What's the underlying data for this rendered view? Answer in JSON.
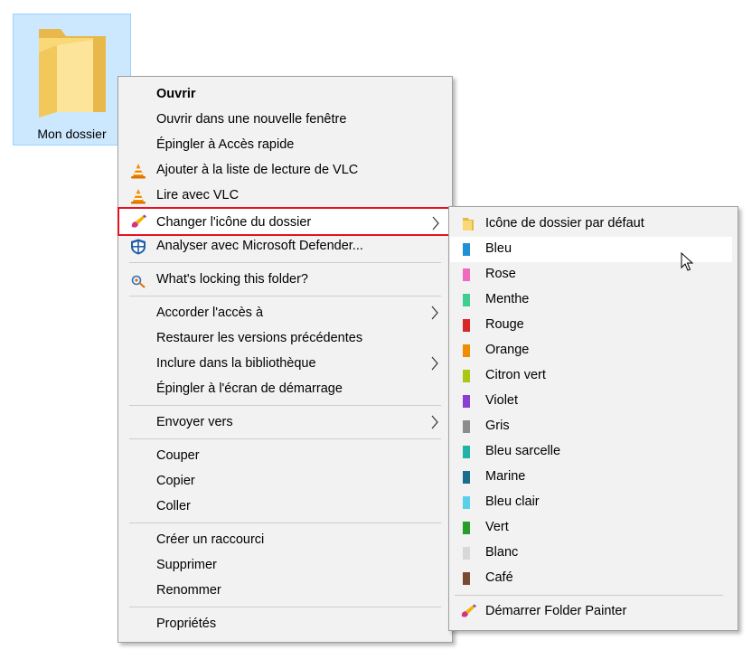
{
  "desktop": {
    "folder_label": "Mon dossier",
    "folder_icon": "folder-icon"
  },
  "main_menu": {
    "open": "Ouvrir",
    "open_new_window": "Ouvrir dans une nouvelle fenêtre",
    "pin_quick_access": "Épingler à Accès rapide",
    "vlc_add_playlist": "Ajouter à la liste de lecture de VLC",
    "vlc_play": "Lire avec VLC",
    "change_folder_icon": "Changer l'icône du dossier",
    "defender_scan": "Analyser avec Microsoft Defender...",
    "whats_locking": "What's locking this folder?",
    "give_access": "Accorder l'accès à",
    "restore_versions": "Restaurer les versions précédentes",
    "include_library": "Inclure dans la bibliothèque",
    "pin_start": "Épingler à l'écran de démarrage",
    "send_to": "Envoyer vers",
    "cut": "Couper",
    "copy": "Copier",
    "paste": "Coller",
    "create_shortcut": "Créer un raccourci",
    "delete": "Supprimer",
    "rename": "Renommer",
    "properties": "Propriétés"
  },
  "sub_menu": {
    "default": {
      "label": "Icône de dossier par défaut",
      "color": "#f8d775"
    },
    "colors": [
      {
        "label": "Bleu",
        "color": "#1e90d6"
      },
      {
        "label": "Rose",
        "color": "#f06ac0"
      },
      {
        "label": "Menthe",
        "color": "#3ecf8e"
      },
      {
        "label": "Rouge",
        "color": "#d62828"
      },
      {
        "label": "Orange",
        "color": "#f08c00"
      },
      {
        "label": "Citron vert",
        "color": "#a8c814"
      },
      {
        "label": "Violet",
        "color": "#8a3fd1"
      },
      {
        "label": "Gris",
        "color": "#8c8c8c"
      },
      {
        "label": "Bleu sarcelle",
        "color": "#22b2a8"
      },
      {
        "label": "Marine",
        "color": "#1b6e8e"
      },
      {
        "label": "Bleu clair",
        "color": "#5ad0ea"
      },
      {
        "label": "Vert",
        "color": "#2a9d2a"
      },
      {
        "label": "Blanc",
        "color": "#d8d8d8"
      },
      {
        "label": "Café",
        "color": "#7a4a32"
      }
    ],
    "start_painter": "Démarrer Folder Painter"
  },
  "colors": {
    "highlight_border": "#e81123",
    "menu_bg": "#f2f2f2",
    "selection": "#cce8ff"
  }
}
